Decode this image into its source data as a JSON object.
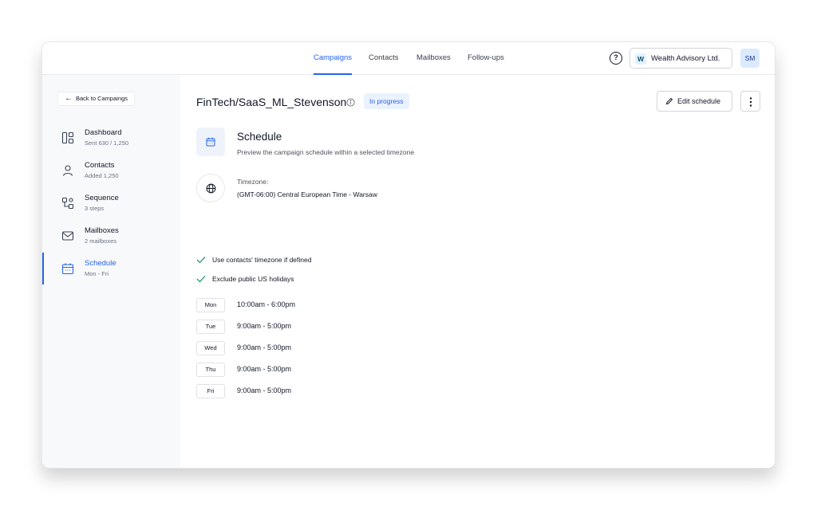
{
  "nav": {
    "tabs": [
      {
        "label": "Campaigns",
        "active": true
      },
      {
        "label": "Contacts",
        "active": false
      },
      {
        "label": "Mailboxes",
        "active": false
      },
      {
        "label": "Follow-ups",
        "active": false
      }
    ],
    "help_icon": "question-circle-icon",
    "org_logo": "W",
    "org_name": "Wealth Advisory Ltd.",
    "avatar_initials": "SM"
  },
  "sidebar": {
    "back_label": "Back to Campaings",
    "items": [
      {
        "label": "Dashboard",
        "sub": "Sent 630 / 1,250",
        "icon": "dashboard-icon",
        "active": false
      },
      {
        "label": "Contacts",
        "sub": "Added 1,250",
        "icon": "user-icon",
        "active": false
      },
      {
        "label": "Sequence",
        "sub": "3 steps",
        "icon": "sequence-icon",
        "active": false
      },
      {
        "label": "Mailboxes",
        "sub": "2 mailboxes",
        "icon": "mail-icon",
        "active": false
      },
      {
        "label": "Schedule",
        "sub": "Mon - Fri",
        "icon": "calendar-icon",
        "active": true
      }
    ]
  },
  "header": {
    "title": "FinTech/SaaS_ML_Stevenson",
    "status": "In progress",
    "edit_label": "Edit schedule"
  },
  "schedule": {
    "title": "Schedule",
    "description": "Preview the campaign schedule within a selected timezone",
    "timezone_label": "Timezone:",
    "timezone_value": "(GMT-06:00) Central European Time - Warsaw",
    "options": [
      {
        "label": "Use contacts' timezone if defined",
        "checked": true
      },
      {
        "label": "Exclude public US holidays",
        "checked": true
      }
    ],
    "days": [
      {
        "day": "Mon",
        "hours": "10:00am - 6:00pm"
      },
      {
        "day": "Tue",
        "hours": "9:00am - 5:00pm"
      },
      {
        "day": "Wed",
        "hours": "9:00am - 5:00pm"
      },
      {
        "day": "Thu",
        "hours": "9:00am - 5:00pm"
      },
      {
        "day": "Fri",
        "hours": "9:00am - 5:00pm"
      }
    ]
  },
  "colors": {
    "accent": "#2563eb",
    "check": "#22a06b",
    "sidebar_bg": "#f8f9fb"
  }
}
